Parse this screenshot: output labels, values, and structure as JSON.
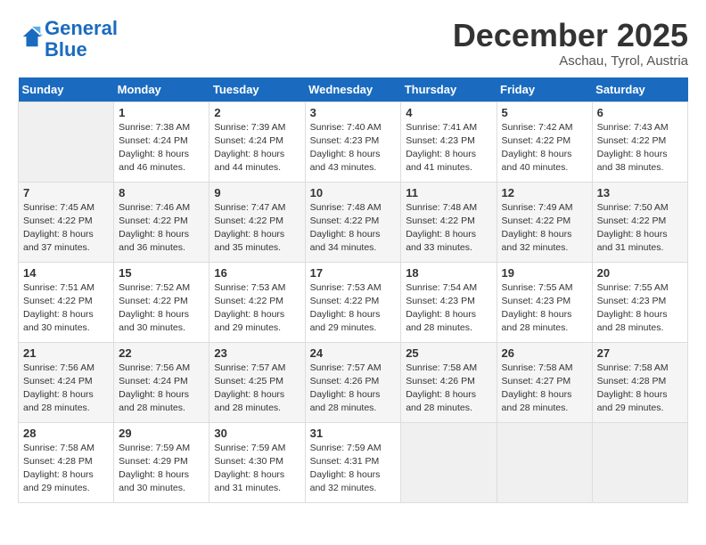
{
  "header": {
    "logo_line1": "General",
    "logo_line2": "Blue",
    "month": "December 2025",
    "location": "Aschau, Tyrol, Austria"
  },
  "days_of_week": [
    "Sunday",
    "Monday",
    "Tuesday",
    "Wednesday",
    "Thursday",
    "Friday",
    "Saturday"
  ],
  "weeks": [
    [
      {
        "day": "",
        "empty": true
      },
      {
        "day": "1",
        "sunrise": "7:38 AM",
        "sunset": "4:24 PM",
        "daylight": "8 hours and 46 minutes."
      },
      {
        "day": "2",
        "sunrise": "7:39 AM",
        "sunset": "4:24 PM",
        "daylight": "8 hours and 44 minutes."
      },
      {
        "day": "3",
        "sunrise": "7:40 AM",
        "sunset": "4:23 PM",
        "daylight": "8 hours and 43 minutes."
      },
      {
        "day": "4",
        "sunrise": "7:41 AM",
        "sunset": "4:23 PM",
        "daylight": "8 hours and 41 minutes."
      },
      {
        "day": "5",
        "sunrise": "7:42 AM",
        "sunset": "4:22 PM",
        "daylight": "8 hours and 40 minutes."
      },
      {
        "day": "6",
        "sunrise": "7:43 AM",
        "sunset": "4:22 PM",
        "daylight": "8 hours and 38 minutes."
      }
    ],
    [
      {
        "day": "7",
        "sunrise": "7:45 AM",
        "sunset": "4:22 PM",
        "daylight": "8 hours and 37 minutes."
      },
      {
        "day": "8",
        "sunrise": "7:46 AM",
        "sunset": "4:22 PM",
        "daylight": "8 hours and 36 minutes."
      },
      {
        "day": "9",
        "sunrise": "7:47 AM",
        "sunset": "4:22 PM",
        "daylight": "8 hours and 35 minutes."
      },
      {
        "day": "10",
        "sunrise": "7:48 AM",
        "sunset": "4:22 PM",
        "daylight": "8 hours and 34 minutes."
      },
      {
        "day": "11",
        "sunrise": "7:48 AM",
        "sunset": "4:22 PM",
        "daylight": "8 hours and 33 minutes."
      },
      {
        "day": "12",
        "sunrise": "7:49 AM",
        "sunset": "4:22 PM",
        "daylight": "8 hours and 32 minutes."
      },
      {
        "day": "13",
        "sunrise": "7:50 AM",
        "sunset": "4:22 PM",
        "daylight": "8 hours and 31 minutes."
      }
    ],
    [
      {
        "day": "14",
        "sunrise": "7:51 AM",
        "sunset": "4:22 PM",
        "daylight": "8 hours and 30 minutes."
      },
      {
        "day": "15",
        "sunrise": "7:52 AM",
        "sunset": "4:22 PM",
        "daylight": "8 hours and 30 minutes."
      },
      {
        "day": "16",
        "sunrise": "7:53 AM",
        "sunset": "4:22 PM",
        "daylight": "8 hours and 29 minutes."
      },
      {
        "day": "17",
        "sunrise": "7:53 AM",
        "sunset": "4:22 PM",
        "daylight": "8 hours and 29 minutes."
      },
      {
        "day": "18",
        "sunrise": "7:54 AM",
        "sunset": "4:23 PM",
        "daylight": "8 hours and 28 minutes."
      },
      {
        "day": "19",
        "sunrise": "7:55 AM",
        "sunset": "4:23 PM",
        "daylight": "8 hours and 28 minutes."
      },
      {
        "day": "20",
        "sunrise": "7:55 AM",
        "sunset": "4:23 PM",
        "daylight": "8 hours and 28 minutes."
      }
    ],
    [
      {
        "day": "21",
        "sunrise": "7:56 AM",
        "sunset": "4:24 PM",
        "daylight": "8 hours and 28 minutes."
      },
      {
        "day": "22",
        "sunrise": "7:56 AM",
        "sunset": "4:24 PM",
        "daylight": "8 hours and 28 minutes."
      },
      {
        "day": "23",
        "sunrise": "7:57 AM",
        "sunset": "4:25 PM",
        "daylight": "8 hours and 28 minutes."
      },
      {
        "day": "24",
        "sunrise": "7:57 AM",
        "sunset": "4:26 PM",
        "daylight": "8 hours and 28 minutes."
      },
      {
        "day": "25",
        "sunrise": "7:58 AM",
        "sunset": "4:26 PM",
        "daylight": "8 hours and 28 minutes."
      },
      {
        "day": "26",
        "sunrise": "7:58 AM",
        "sunset": "4:27 PM",
        "daylight": "8 hours and 28 minutes."
      },
      {
        "day": "27",
        "sunrise": "7:58 AM",
        "sunset": "4:28 PM",
        "daylight": "8 hours and 29 minutes."
      }
    ],
    [
      {
        "day": "28",
        "sunrise": "7:58 AM",
        "sunset": "4:28 PM",
        "daylight": "8 hours and 29 minutes."
      },
      {
        "day": "29",
        "sunrise": "7:59 AM",
        "sunset": "4:29 PM",
        "daylight": "8 hours and 30 minutes."
      },
      {
        "day": "30",
        "sunrise": "7:59 AM",
        "sunset": "4:30 PM",
        "daylight": "8 hours and 31 minutes."
      },
      {
        "day": "31",
        "sunrise": "7:59 AM",
        "sunset": "4:31 PM",
        "daylight": "8 hours and 32 minutes."
      },
      {
        "day": "",
        "empty": true
      },
      {
        "day": "",
        "empty": true
      },
      {
        "day": "",
        "empty": true
      }
    ]
  ]
}
